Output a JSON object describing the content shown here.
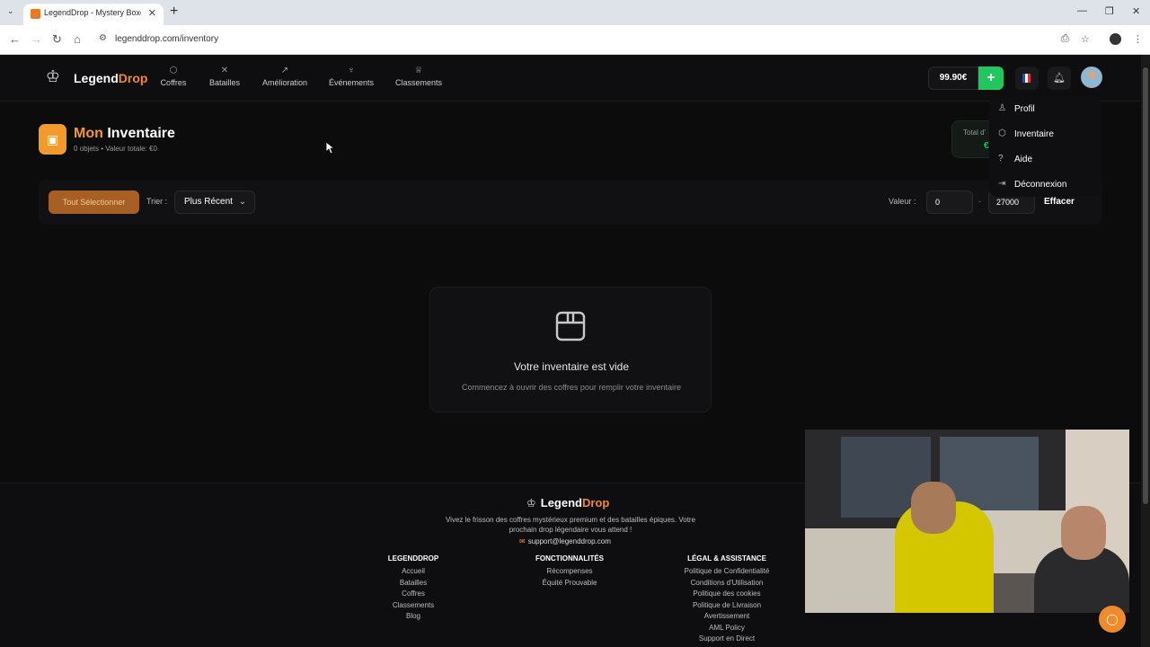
{
  "browser": {
    "tab_title": "LegendDrop - Mystery Boxes &",
    "url": "legenddrop.com/inventory"
  },
  "header": {
    "logo_main": "Legend",
    "logo_accent": "Drop",
    "nav": [
      {
        "label": "Coffres",
        "icon": "box-icon"
      },
      {
        "label": "Batailles",
        "icon": "swords-icon"
      },
      {
        "label": "Amélioration",
        "icon": "trending-up-icon"
      },
      {
        "label": "Événements",
        "icon": "trophy-icon"
      },
      {
        "label": "Classements",
        "icon": "crown-icon"
      }
    ],
    "balance": "99.90€",
    "plus": "+"
  },
  "page": {
    "title_accent": "Mon",
    "title_rest": " Inventaire",
    "subtitle": "0 objets • Valeur totale: €0",
    "total_label": "Total d'",
    "total_value": "€"
  },
  "toolbar": {
    "select_all": "Tout Sélectionner",
    "sort_label": "Trier :",
    "sort_value": "Plus Récent",
    "value_label": "Valeur :",
    "value_min": "0",
    "value_dash": "-",
    "value_max": "27000",
    "clear": "Effacer"
  },
  "empty": {
    "heading": "Votre inventaire est vide",
    "text": "Commencez à ouvrir des coffres pour remplir votre inventaire"
  },
  "dropdown": [
    {
      "label": "Profil",
      "icon": "user-icon"
    },
    {
      "label": "Inventaire",
      "icon": "package-icon"
    },
    {
      "label": "Aide",
      "icon": "help-circle-icon"
    },
    {
      "label": "Déconnexion",
      "icon": "logout-icon"
    }
  ],
  "footer": {
    "logo_main": "Legend",
    "logo_accent": "Drop",
    "tagline": "Vivez le frisson des coffres mystérieux premium et des batailles épiques. Votre prochain drop légendaire vous attend !",
    "email": "support@legenddrop.com",
    "columns": [
      {
        "heading": "LEGENDDROP",
        "links": [
          "Accueil",
          "Batailles",
          "Coffres",
          "Classements",
          "Blog"
        ]
      },
      {
        "heading": "FONCTIONNALITÉS",
        "links": [
          "Récompenses",
          "Équité Prouvable"
        ]
      },
      {
        "heading": "LÉGAL & ASSISTANCE",
        "links": [
          "Politique de Confidentialité",
          "Conditions d'Utilisation",
          "Politique des cookies",
          "Politique de Livraison",
          "Avertissement",
          "AML Policy",
          "Support en Direct"
        ]
      }
    ]
  },
  "colors": {
    "accent": "#f08b2c",
    "green": "#22c55e",
    "background": "#0c0c0d"
  }
}
